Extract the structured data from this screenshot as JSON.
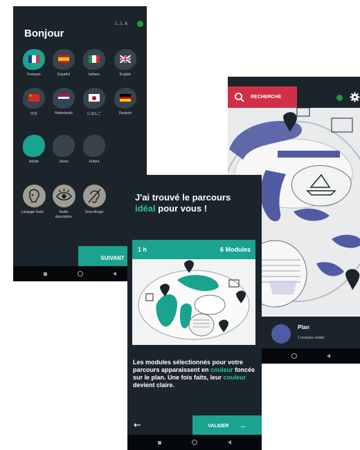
{
  "screen1": {
    "version": "1.1.6",
    "greeting": "Bonjour",
    "languages": [
      "Français",
      "Español",
      "Italiano",
      "English",
      "中文",
      "Nederlands",
      "にほんご",
      "Deutsch"
    ],
    "audiences": [
      "Adulte",
      "Jeune",
      "Enfant"
    ],
    "accessibility": [
      "Langage facile",
      "Audio description",
      "Sous-titrage"
    ],
    "next_label": "SUIVANT",
    "colors": {
      "accent": "#1aa38f",
      "background": "#1c242b",
      "status": "#1a9e32"
    }
  },
  "screen2": {
    "search_label": "RECHERCHE",
    "plan_title": "Plan",
    "plan_subtitle": "1 modules visités",
    "colors": {
      "search": "#d12f48",
      "map_zone": "#515ba3"
    }
  },
  "screen3": {
    "headline_part1": "J'ai trouvé le parcours",
    "headline_highlight": "idéal",
    "headline_part2": "pour vous !",
    "duration": "1 h",
    "modules": "6 Modules",
    "text_part1": "Les modules sélectionnés pour votre parcours apparaissent en",
    "text_highlight1": "couleur",
    "text_part2": "foncée sur le plan. Une fois faits, leur",
    "text_highlight2": "couleur",
    "text_part3": "devient claire.",
    "validate_label": "VALIDER",
    "back_icon": "arrow-left-icon"
  }
}
